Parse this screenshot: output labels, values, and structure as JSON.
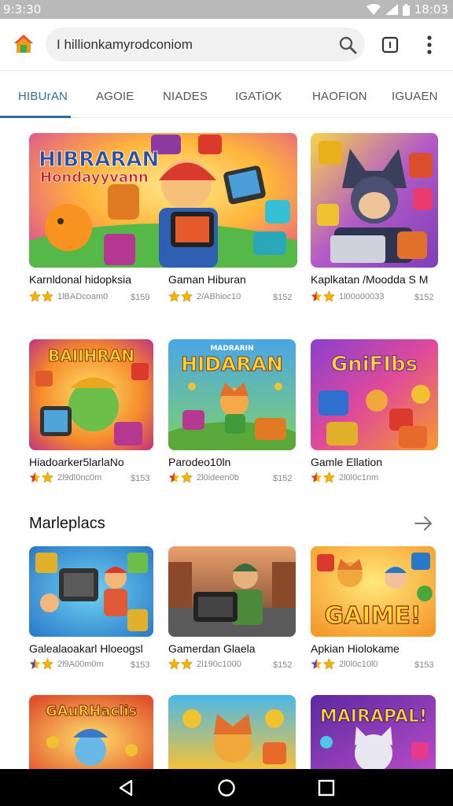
{
  "status": {
    "time": "9:3:30",
    "clock_right": "18:03"
  },
  "url_bar": {
    "url": "I hillionkamyrodconiom"
  },
  "tabs": [
    "HIBUrAN",
    "AGOIE",
    "NIADES",
    "IGATiOK",
    "HAOFION",
    "IGUAEN"
  ],
  "cards_row1": [
    {
      "title": "Karnldonal hidopksia",
      "meta": "1lBADcoam0",
      "price": "$159",
      "art_text": "HIBRARAN",
      "art_text2": "Hondayyvann"
    },
    {
      "title": "Gaman Hiburan",
      "meta": "2/ABhioc10",
      "price": "$152",
      "art_text": "",
      "art_text2": ""
    },
    {
      "title": "Kaplkatan /Moodda S M",
      "meta": "1l00o00033",
      "price": "$152",
      "art_text": "",
      "art_text2": ""
    }
  ],
  "cards_row2": [
    {
      "title": "Hiadoarker5larlaNo",
      "meta": "2l9dl0nc0m",
      "price": "$153",
      "art_text": "BAIIHRAN"
    },
    {
      "title": "Parodeo10ln",
      "meta": "2l0ideen0b",
      "price": "$152",
      "art_text": "HIDARAN",
      "art_sub": "MADRARIN"
    },
    {
      "title": "Gamle Ellation",
      "meta": "2l0l0c1nm",
      "price": "",
      "art_text": "GniFIbs"
    }
  ],
  "section": {
    "title": "Marleplacs"
  },
  "cards_row3": [
    {
      "title": "Galealaoakarl Hloeogsl",
      "meta": "2l9A00m0m",
      "price": "$153"
    },
    {
      "title": "Gamerdan Glaela",
      "meta": "2l190c1000",
      "price": "$152"
    },
    {
      "title": "Apkian Hiolokame",
      "meta": "2l0l0c10l0",
      "price": "$153",
      "art_text": "GAIME!"
    }
  ],
  "cards_row4": [
    {
      "art_text": "GAuRHaclis"
    },
    {
      "art_text": ""
    },
    {
      "art_text": "MAIRAPAL!"
    }
  ],
  "colors": {
    "accent": "#2e6f9e",
    "star": "#f5b400"
  },
  "icons": [
    "home-icon",
    "search-icon",
    "tabs-icon",
    "menu-icon",
    "arrow-right-icon",
    "back-icon",
    "home-nav-icon",
    "recents-icon",
    "star-icon"
  ]
}
